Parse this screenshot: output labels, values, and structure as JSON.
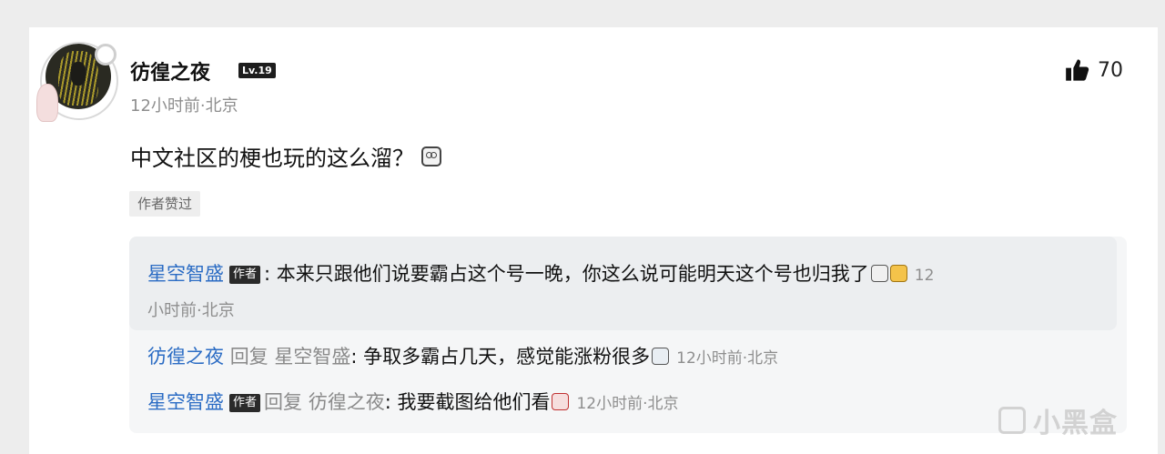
{
  "comment": {
    "username": "彷徨之夜",
    "level_badge": "Lv.19",
    "meta": "12小时前·北京",
    "content": "中文社区的梗也玩的这么溜？",
    "content_emoji": "peeking-face-emoji",
    "author_liked_tag": "作者赞过",
    "likes": "70"
  },
  "replies": [
    {
      "name": "星空智盛",
      "author_tag": "作者",
      "separator": ":",
      "text": "本来只跟他们说要霸占这个号一晚，你这么说可能明天这个号也归我了",
      "emojis": [
        "sunglasses-emoji",
        "cat-emoji"
      ],
      "time_part1": "12",
      "time_part2": "小时前·北京"
    },
    {
      "name": "彷徨之夜",
      "reply_word": "回复",
      "reply_to": "星空智盛",
      "separator": ":",
      "text": "争取多霸占几天，感觉能涨粉很多",
      "emojis": [
        "teary-face-emoji"
      ],
      "time": "12小时前·北京"
    },
    {
      "name": "星空智盛",
      "author_tag": "作者",
      "reply_word": "回复",
      "reply_to": "彷徨之夜",
      "separator": ":",
      "text": "我要截图给他们看",
      "emojis": [
        "red-face-emoji"
      ],
      "time": "12小时前·北京"
    }
  ],
  "watermark": "小黑盒",
  "colors": {
    "link_blue": "#2b6cc4",
    "gray_text": "#8e8e8e",
    "reply_bg": "#f5f6f7"
  }
}
